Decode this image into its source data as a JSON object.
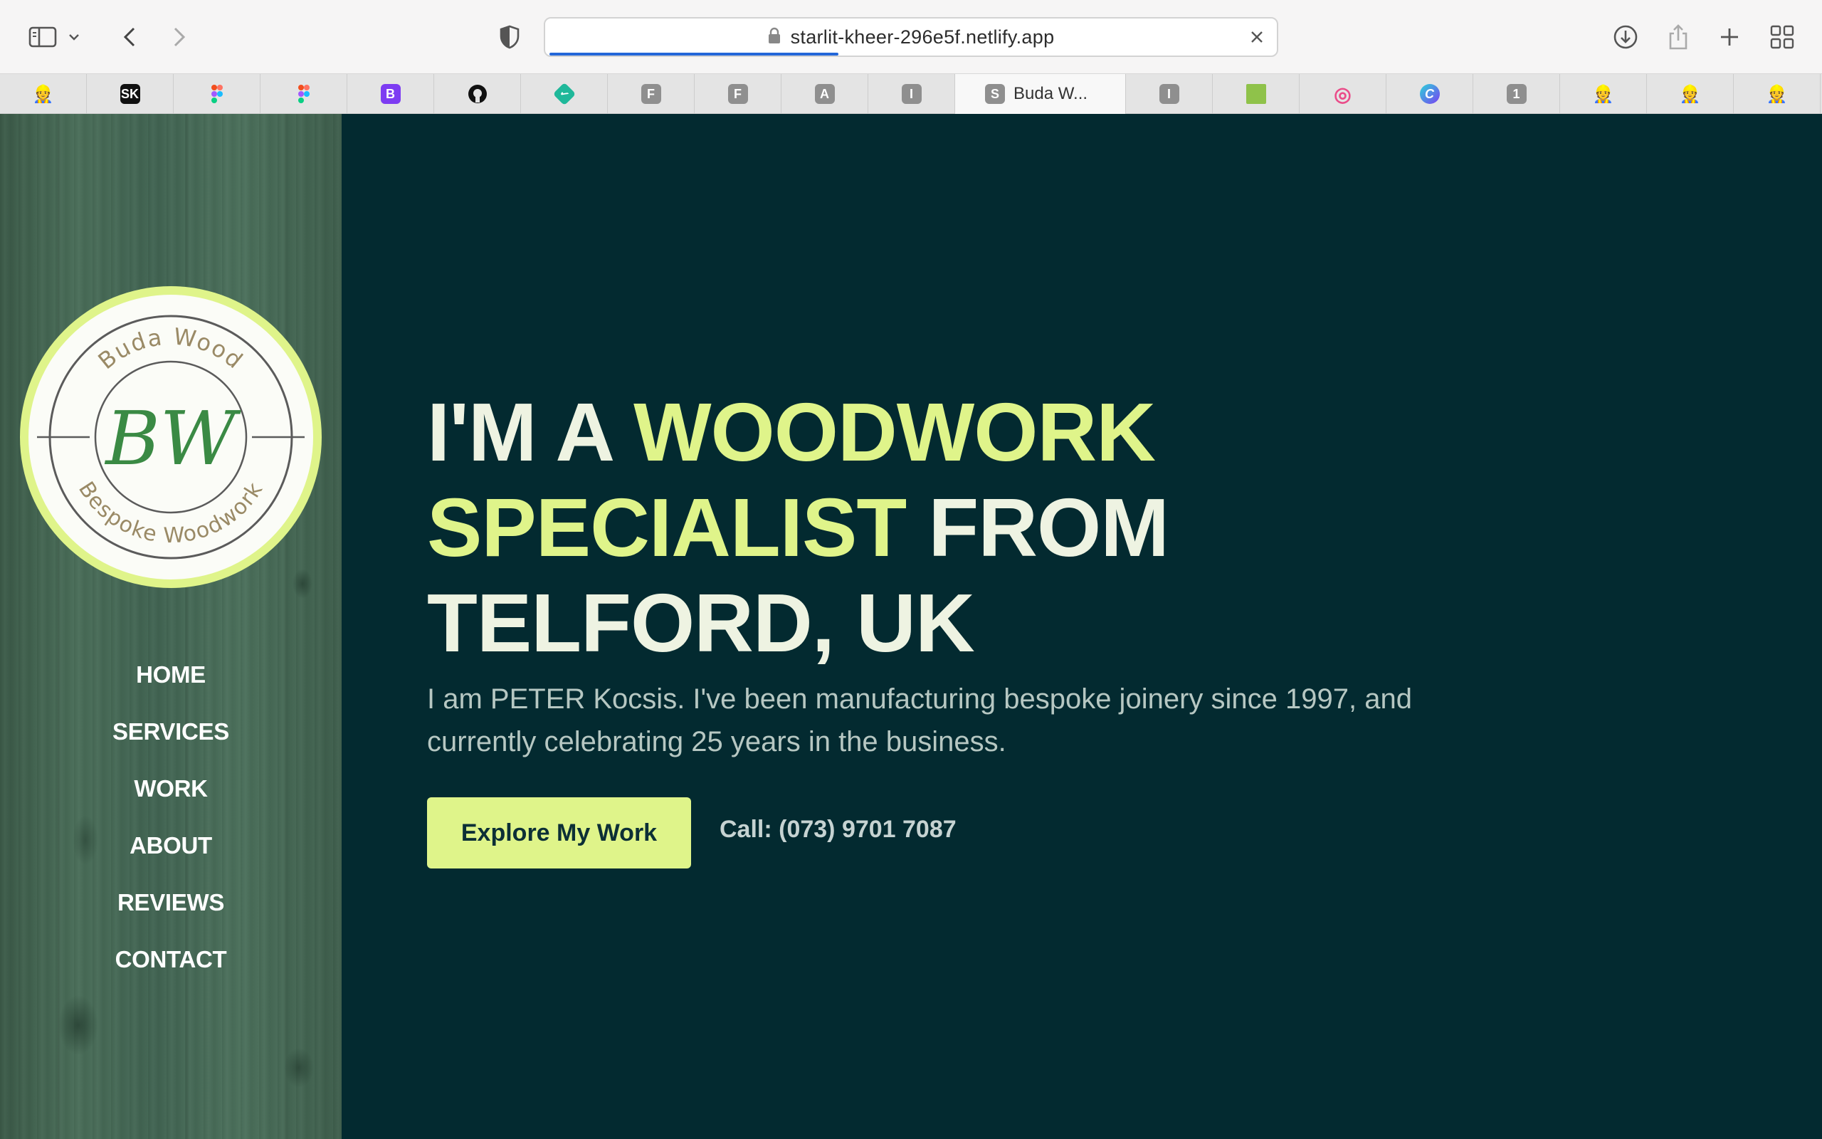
{
  "browser": {
    "url": "starlit-kheer-296e5f.netlify.app",
    "tabs": [
      {
        "icon": "hardhat-emoji",
        "glyph": "👷"
      },
      {
        "icon": "sk-icon",
        "glyph": "SK",
        "color": "#111111"
      },
      {
        "icon": "figma-icon",
        "glyph": ""
      },
      {
        "icon": "figma-icon",
        "glyph": ""
      },
      {
        "icon": "bootstrap-icon",
        "glyph": "B",
        "color": "#7d3cf2"
      },
      {
        "icon": "github-icon",
        "glyph": ""
      },
      {
        "icon": "checkmark-diamond-icon",
        "glyph": "✓",
        "color": "#1fb89a"
      },
      {
        "icon": "letter-f-icon",
        "glyph": "F",
        "color": "#8f8f8f"
      },
      {
        "icon": "letter-f-icon",
        "glyph": "F",
        "color": "#8f8f8f"
      },
      {
        "icon": "letter-a-icon",
        "glyph": "A",
        "color": "#8f8f8f"
      },
      {
        "icon": "letter-i-icon",
        "glyph": "I",
        "color": "#8f8f8f"
      },
      {
        "icon": "letter-s-icon",
        "glyph": "S",
        "color": "#8f8f8f",
        "title": "Buda W...",
        "active": true
      },
      {
        "icon": "letter-i-icon",
        "glyph": "I",
        "color": "#8f8f8f"
      },
      {
        "icon": "green-site-icon",
        "glyph": "",
        "color": "#8fc24a"
      },
      {
        "icon": "dribbble-icon",
        "glyph": "◎",
        "color": "#ea4c89"
      },
      {
        "icon": "canva-icon",
        "glyph": "C",
        "color": "#3b7cf0"
      },
      {
        "icon": "number-1-icon",
        "glyph": "1",
        "color": "#8f8f8f"
      },
      {
        "icon": "hardhat-emoji",
        "glyph": "👷"
      },
      {
        "icon": "hardhat-emoji",
        "glyph": "👷"
      },
      {
        "icon": "hardhat-emoji",
        "glyph": "👷"
      }
    ]
  },
  "logo": {
    "top_text": "Buda Wood",
    "monogram": "BW",
    "bottom_text": "Bespoke Woodwork",
    "ring_color": "#dff48a"
  },
  "nav": {
    "items": [
      "HOME",
      "SERVICES",
      "WORK",
      "ABOUT",
      "REVIEWS",
      "CONTACT"
    ]
  },
  "hero": {
    "headline_part1": "I'M A ",
    "headline_highlight1": "WOODWORK",
    "headline_highlight2": "SPECIALIST",
    "headline_part2": " FROM",
    "headline_part3": "TELFORD, UK",
    "intro": "I am PETER Kocsis. I've been manufacturing bespoke joinery since 1997, and currently celebrating 25 years in the business.",
    "cta_label": "Explore My Work",
    "call_text": "Call: (073) 9701 7087"
  },
  "colors": {
    "accent": "#dff48a",
    "main_bg": "#032a30",
    "headline_white": "#eef3e2"
  }
}
